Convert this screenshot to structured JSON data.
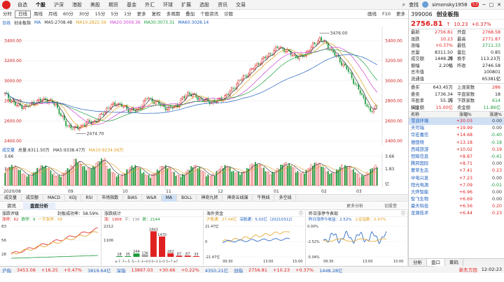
{
  "menu": {
    "items": [
      "自选",
      "个股",
      "沪深",
      "港股",
      "美股",
      "期货",
      "基金",
      "外汇",
      "环球",
      "扩展",
      "选股",
      "资讯",
      "交易"
    ],
    "active": 1,
    "search_label": "查找",
    "user": "simonsky1958",
    "badge": "53"
  },
  "toolbar": {
    "items": [
      "分时",
      "日线",
      "周线",
      "月线",
      "60分",
      "30分",
      "15分",
      "5分",
      "1分",
      "更多",
      "复权",
      "多周期",
      "叠加",
      "个股资讯",
      "诊股"
    ],
    "selected": 1,
    "right": [
      "画线",
      "F10",
      "更多"
    ]
  },
  "legend": {
    "label": "日线",
    "name": "创业板指",
    "ma": "MA",
    "ma5": "MA5:2708.48",
    "ma10": "MA10:2822.56",
    "ma20": "MA20:3009.36",
    "ma30": "MA30:3073.31",
    "ma60": "MA60:3028.14"
  },
  "colors": {
    "up": "#e02020",
    "down": "#1a9a3a",
    "ma5": "#333333",
    "ma10": "#e0a020",
    "ma20": "#d040d0",
    "ma30": "#20a040",
    "ma60": "#2060c0"
  },
  "price_axis": [
    "3400.00",
    "3200.00",
    "3000.00",
    "2800.00",
    "2600.00",
    "2400.00"
  ],
  "annotations": {
    "high": "3476.00",
    "low": "2474.70"
  },
  "volume": {
    "legend_label": "成交量",
    "total": "总量:8311.50万",
    "ma5": "MA5:9338.47万",
    "ma10": "MA10:9234.06万",
    "axis": [
      "3.66",
      "1.83"
    ],
    "unit": "亿"
  },
  "dates": [
    "2020/08",
    "09",
    "10",
    "11",
    "12",
    "01",
    "02",
    "03"
  ],
  "indicators": {
    "items": [
      "成交量",
      "成交额",
      "MACD",
      "KDJ",
      "RSI",
      "市场指数",
      "BIAS",
      "W&R",
      "MA",
      "BOLL",
      "神奇九转",
      "神奇五线谱",
      "牛熊线",
      "多空线"
    ],
    "selected": 8
  },
  "info_tabs": {
    "items": [
      "资讯",
      "盘面分析"
    ],
    "selected": 1,
    "right": [
      "更多分析",
      "论股堂"
    ]
  },
  "panels": {
    "p1": {
      "title": "涨跌评级",
      "right": "封板成功率：58.59%",
      "legend": [
        "涨停：62",
        "跌停：9",
        "一字涨停：58"
      ],
      "axis": [
        "83",
        "56",
        "28"
      ]
    },
    "p2": {
      "title": "涨跌统计",
      "legend": [
        "涨：1906",
        "平：136",
        "跌：2144"
      ],
      "bars": [
        18,
        35,
        244,
        136,
        1843,
        1470,
        262,
        87,
        87,
        33
      ],
      "labels": [
        "18",
        "35",
        "244",
        "136",
        "1843",
        "1470",
        "262",
        "87",
        "87",
        "33"
      ],
      "axis_top": "2212",
      "axis_mid": "1106",
      "xaxis": "≤-7 -7~-5 -5~-3 -3~0 0 0~3 3~5 5~7 ≥7"
    },
    "p3": {
      "title": "海外资金",
      "legend": [
        "沪股通：27.44亿",
        "深股通：5.02亿（20210312）"
      ],
      "axis": [
        "21.47亿",
        "0",
        "-21.47亿"
      ],
      "xaxis": [
        "09:30",
        "13:00",
        "15:00"
      ]
    },
    "p4": {
      "title": "昨日涨停今表现",
      "legend": [
        "昨日涨停今收益：2.52%",
        "上证指数：0.47%"
      ],
      "axis": [
        "0.00%",
        "-2.52%",
        "-5.04%"
      ],
      "xaxis": [
        "09:30",
        "13:00",
        "15:00"
      ]
    }
  },
  "statusbar": {
    "sh_label": "沪指",
    "sh_val": "3453.08",
    "sh_ch": "+16.25",
    "sh_pct": "+0.47%",
    "sh_amt": "3819.64亿",
    "sz_label": "深指",
    "sz_val": "13897.03",
    "sz_ch": "+30.66",
    "sz_pct": "+0.22%",
    "sz_amt": "4350.21亿",
    "cy_label": "创指",
    "cy_val": "2756.81",
    "cy_ch": "+10.23",
    "cy_pct": "+0.37%",
    "cy_amt": "1448.28亿",
    "news": "新东方回",
    "time": "12:02:23"
  },
  "quote": {
    "code": "399006",
    "name": "创业板指",
    "price": "2756.81",
    "change": "10.23",
    "pct": "+0.37%",
    "rows": [
      [
        "最新",
        "2756.81",
        "开盘",
        "2768.58"
      ],
      [
        "涨跌",
        "10.23",
        "最高",
        "2771.87"
      ],
      [
        "涨幅",
        "+0.37%",
        "最低",
        "2711.33"
      ],
      [
        "总量",
        "8311.50万",
        "量比",
        "0.85"
      ],
      [
        "成交额",
        "1448.28亿",
        "换手",
        "113.23万"
      ],
      [
        "振幅",
        "2.20%",
        "昨收",
        "2746.58"
      ],
      [
        "总市值",
        "",
        "",
        "100801亿"
      ],
      [
        "流通值",
        "",
        "",
        "65381亿"
      ]
    ],
    "rows2": [
      [
        "委买",
        "643.45万",
        "上涨家数",
        "286"
      ],
      [
        "委卖",
        "1736.34万",
        "平盘家数",
        "18"
      ],
      [
        "市盈率(动)",
        "55.16",
        "下跌家数",
        "614"
      ],
      [
        "买金额",
        "15.00亿",
        "卖金额",
        "11.86亿"
      ]
    ],
    "table_head": [
      "名称",
      "涨幅%",
      "涨速%"
    ],
    "table": [
      [
        "雪浪环境",
        "+20.03",
        "0.00"
      ],
      [
        "天可瑞",
        "+19.99",
        "0.00"
      ],
      [
        "华宏嘉信",
        "+14.68",
        "-0.40"
      ],
      [
        "德固特",
        "+13.18",
        "-0.18"
      ],
      [
        "西域旅游",
        "+10.02",
        "0.19"
      ],
      [
        "恒辉信息",
        "+8.87",
        "-0.41"
      ],
      [
        "腾邦国际",
        "+8.71",
        "0.00"
      ],
      [
        "蒙草生态",
        "+7.41",
        "0.23"
      ],
      [
        "中电兴发",
        "+7.23",
        "0.00"
      ],
      [
        "阳光电源",
        "+7.09",
        "-0.01"
      ],
      [
        "大烨智能",
        "+6.96",
        "0.00"
      ],
      [
        "智飞生物",
        "+6.69",
        "0.00"
      ],
      [
        "豪天科技",
        "+6.56",
        "0.20"
      ],
      [
        "龙源技术",
        "+6.44",
        "0.23"
      ]
    ],
    "bottom_tabs": [
      "分析",
      "盘口",
      "筹码"
    ],
    "bottom_selected": 1
  },
  "chart_data": {
    "type": "candlestick",
    "title": "创业板指 日线",
    "x": "2020/08 – 2021/03",
    "ylim": [
      2400,
      3500
    ],
    "high": 3476.0,
    "low": 2474.7,
    "last_close": 2756.81
  }
}
